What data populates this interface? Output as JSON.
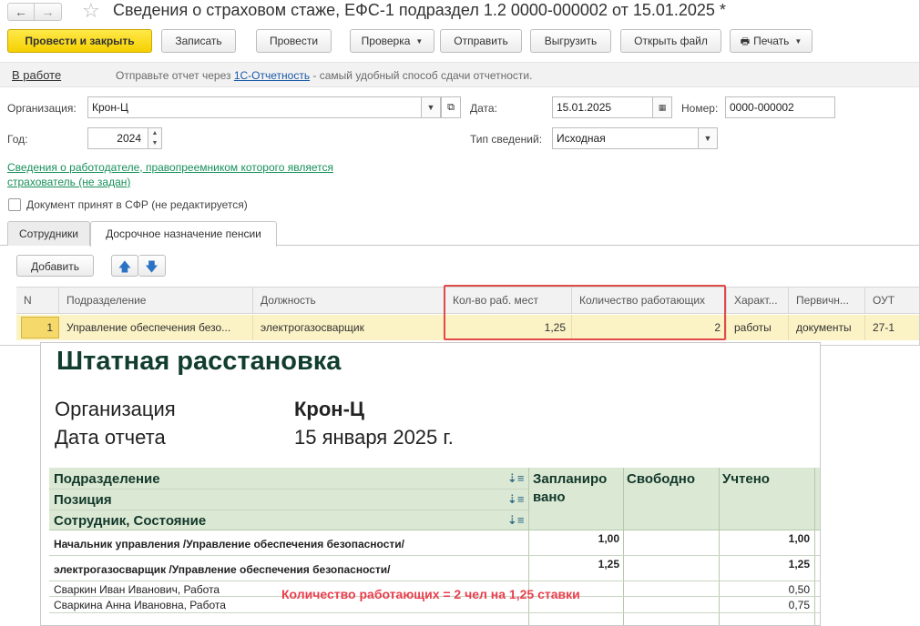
{
  "window": {
    "back_glyph": "←",
    "forward_glyph": "→",
    "title": "Сведения о страховом стаже, ЕФС-1 подраздел 1.2 0000-000002 от 15.01.2025 *"
  },
  "toolbar": {
    "post_close": "Провести и закрыть",
    "save": "Записать",
    "post": "Провести",
    "check": "Проверка",
    "send": "Отправить",
    "export": "Выгрузить",
    "open_file": "Открыть файл",
    "print": "Печать"
  },
  "infobar": {
    "status": "В работе",
    "hint_before": "Отправьте отчет через ",
    "hint_link": "1С-Отчетность",
    "hint_after": " - самый удобный способ сдачи отчетности."
  },
  "form": {
    "org_label": "Организация:",
    "org_value": "Крон-Ц",
    "date_label": "Дата:",
    "date_value": "15.01.2025",
    "number_label": "Номер:",
    "number_value": "0000-000002",
    "year_label": "Год:",
    "year_value": "2024",
    "type_label": "Тип сведений:",
    "type_value": "Исходная",
    "employer_link_1": "Сведения о работодателе, правопреемником которого является",
    "employer_link_2": "страхователь (не задан)",
    "accepted_label": "Документ принят в СФР (не редактируется)"
  },
  "tabs": [
    "Сотрудники",
    "Досрочное назначение пенсии"
  ],
  "tab_toolbar": {
    "add": "Добавить"
  },
  "grid": {
    "columns": [
      "N",
      "Подразделение",
      "Должность",
      "Кол-во раб. мест",
      "Количество работающих",
      "Характ...",
      "Первичн...",
      "ОУТ"
    ],
    "row": [
      "1",
      "Управление обеспечения безо...",
      "электрогазосварщик",
      "1,25",
      "2",
      "работы",
      "документы",
      "27-1"
    ]
  },
  "report": {
    "title": "Штатная расстановка",
    "org_key": "Организация",
    "org_value": "Крон-Ц",
    "date_key": "Дата отчета",
    "date_value": "15 января 2025 г.",
    "header_rows": [
      "Подразделение",
      "Позиция",
      "Сотрудник, Состояние"
    ],
    "col_planned_1": "Запланиро",
    "col_planned_2": "вано",
    "col_free": "Свободно",
    "col_counted": "Учтено",
    "rows": [
      {
        "label": "Начальник управления /Управление обеспечения безопасности/",
        "planned": "1,00",
        "counted": "1,00"
      },
      {
        "label": "электрогазосварщик /Управление обеспечения безопасности/",
        "planned": "1,25",
        "counted": "1,25"
      },
      {
        "label": "Сваркин Иван Иванович, Работа",
        "planned": "",
        "counted": "0,50"
      },
      {
        "label": "Сваркина Анна Ивановна, Работа",
        "planned": "",
        "counted": "0,75"
      }
    ],
    "annotation": "Количество работающих = 2 чел на 1,25 ставки"
  },
  "colors": {
    "primary_button": "#f5d000",
    "selected_row": "#fbf2c5",
    "highlight_box": "#e04a4a",
    "report_header": "#dbe8d3",
    "report_title": "#113d2f",
    "annotation": "#ea3e4d"
  }
}
